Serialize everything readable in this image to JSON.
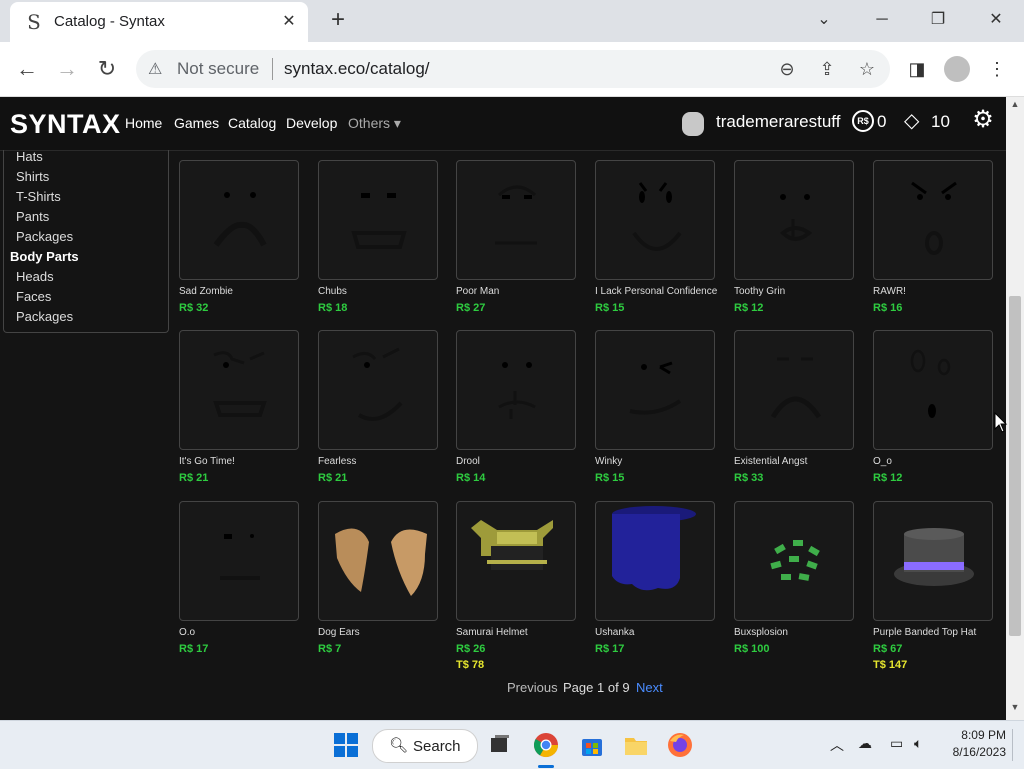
{
  "browser": {
    "tab_title": "Catalog - Syntax",
    "security_label": "Not secure",
    "url": "syntax.eco/catalog/"
  },
  "site": {
    "logo": "SYNTAX",
    "nav": [
      "Home",
      "Games",
      "Catalog",
      "Develop",
      "Others"
    ],
    "username": "trademerarestuff",
    "robux": "0",
    "tix": "10",
    "robux_icon_text": "R$"
  },
  "sidebar": {
    "items": [
      {
        "label": "Hats",
        "bold": false
      },
      {
        "label": "Shirts",
        "bold": false
      },
      {
        "label": "T-Shirts",
        "bold": false
      },
      {
        "label": "Pants",
        "bold": false
      },
      {
        "label": "Packages",
        "bold": false
      },
      {
        "label": "Body Parts",
        "bold": true
      },
      {
        "label": "Heads",
        "bold": false
      },
      {
        "label": "Faces",
        "bold": false
      },
      {
        "label": "Packages",
        "bold": false
      }
    ]
  },
  "catalog": {
    "items": [
      {
        "name": "Sad Zombie",
        "robux": "R$ 32",
        "tix": ""
      },
      {
        "name": "Chubs",
        "robux": "R$ 18",
        "tix": ""
      },
      {
        "name": "Poor Man",
        "robux": "R$ 27",
        "tix": ""
      },
      {
        "name": "I Lack Personal Confidence",
        "robux": "R$ 15",
        "tix": ""
      },
      {
        "name": "Toothy Grin",
        "robux": "R$ 12",
        "tix": ""
      },
      {
        "name": "RAWR!",
        "robux": "R$ 16",
        "tix": ""
      },
      {
        "name": "It's Go Time!",
        "robux": "R$ 21",
        "tix": ""
      },
      {
        "name": "Fearless",
        "robux": "R$ 21",
        "tix": ""
      },
      {
        "name": "Drool",
        "robux": "R$ 14",
        "tix": ""
      },
      {
        "name": "Winky",
        "robux": "R$ 15",
        "tix": ""
      },
      {
        "name": "Existential Angst",
        "robux": "R$ 33",
        "tix": ""
      },
      {
        "name": "O_o",
        "robux": "R$ 12",
        "tix": ""
      },
      {
        "name": "O.o",
        "robux": "R$ 17",
        "tix": ""
      },
      {
        "name": "Dog Ears",
        "robux": "R$ 7",
        "tix": ""
      },
      {
        "name": "Samurai Helmet",
        "robux": "R$ 26",
        "tix": "T$ 78"
      },
      {
        "name": "Ushanka",
        "robux": "R$ 17",
        "tix": ""
      },
      {
        "name": "Buxsplosion",
        "robux": "R$ 100",
        "tix": ""
      },
      {
        "name": "Purple Banded Top Hat",
        "robux": "R$ 67",
        "tix": "T$ 147"
      }
    ]
  },
  "pagination": {
    "previous": "Previous",
    "page_word": "Page",
    "current": "1",
    "of_word": "of",
    "total": "9",
    "next": "Next"
  },
  "taskbar": {
    "search_label": "Search",
    "time": "8:09 PM",
    "date": "8/16/2023"
  },
  "colors": {
    "robux_price": "#2ecc40",
    "tix_price": "#e6e62e",
    "next_link": "#4a8cff",
    "page_bg": "#141414"
  }
}
